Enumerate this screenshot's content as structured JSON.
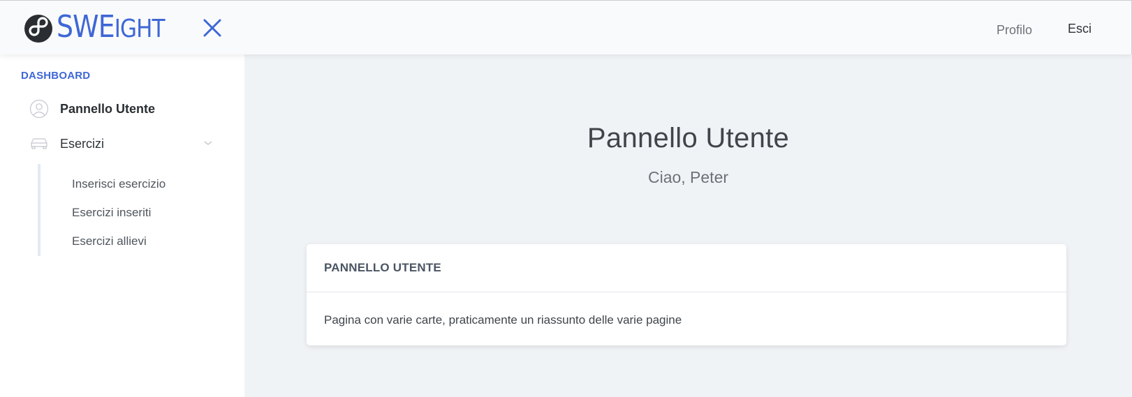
{
  "brand": {
    "name_large": "SWE",
    "name_small": "IGHT",
    "accent_color": "#3e67d6"
  },
  "header": {
    "close_icon": "close-icon",
    "nav": {
      "profile_label": "Profilo",
      "logout_label": "Esci"
    }
  },
  "sidebar": {
    "section_title": "DASHBOARD",
    "items": [
      {
        "label": "Pannello Utente",
        "icon": "user-circle-icon",
        "active": true
      },
      {
        "label": "Esercizi",
        "icon": "car-icon",
        "expanded": true,
        "children": [
          {
            "label": "Inserisci esercizio"
          },
          {
            "label": "Esercizi inseriti"
          },
          {
            "label": "Esercizi allievi"
          }
        ]
      }
    ]
  },
  "main": {
    "title": "Pannello Utente",
    "subtitle": "Ciao, Peter",
    "card": {
      "header": "PANNELLO UTENTE",
      "body": "Pagina con varie carte, praticamente un riassunto delle varie pagine"
    }
  }
}
